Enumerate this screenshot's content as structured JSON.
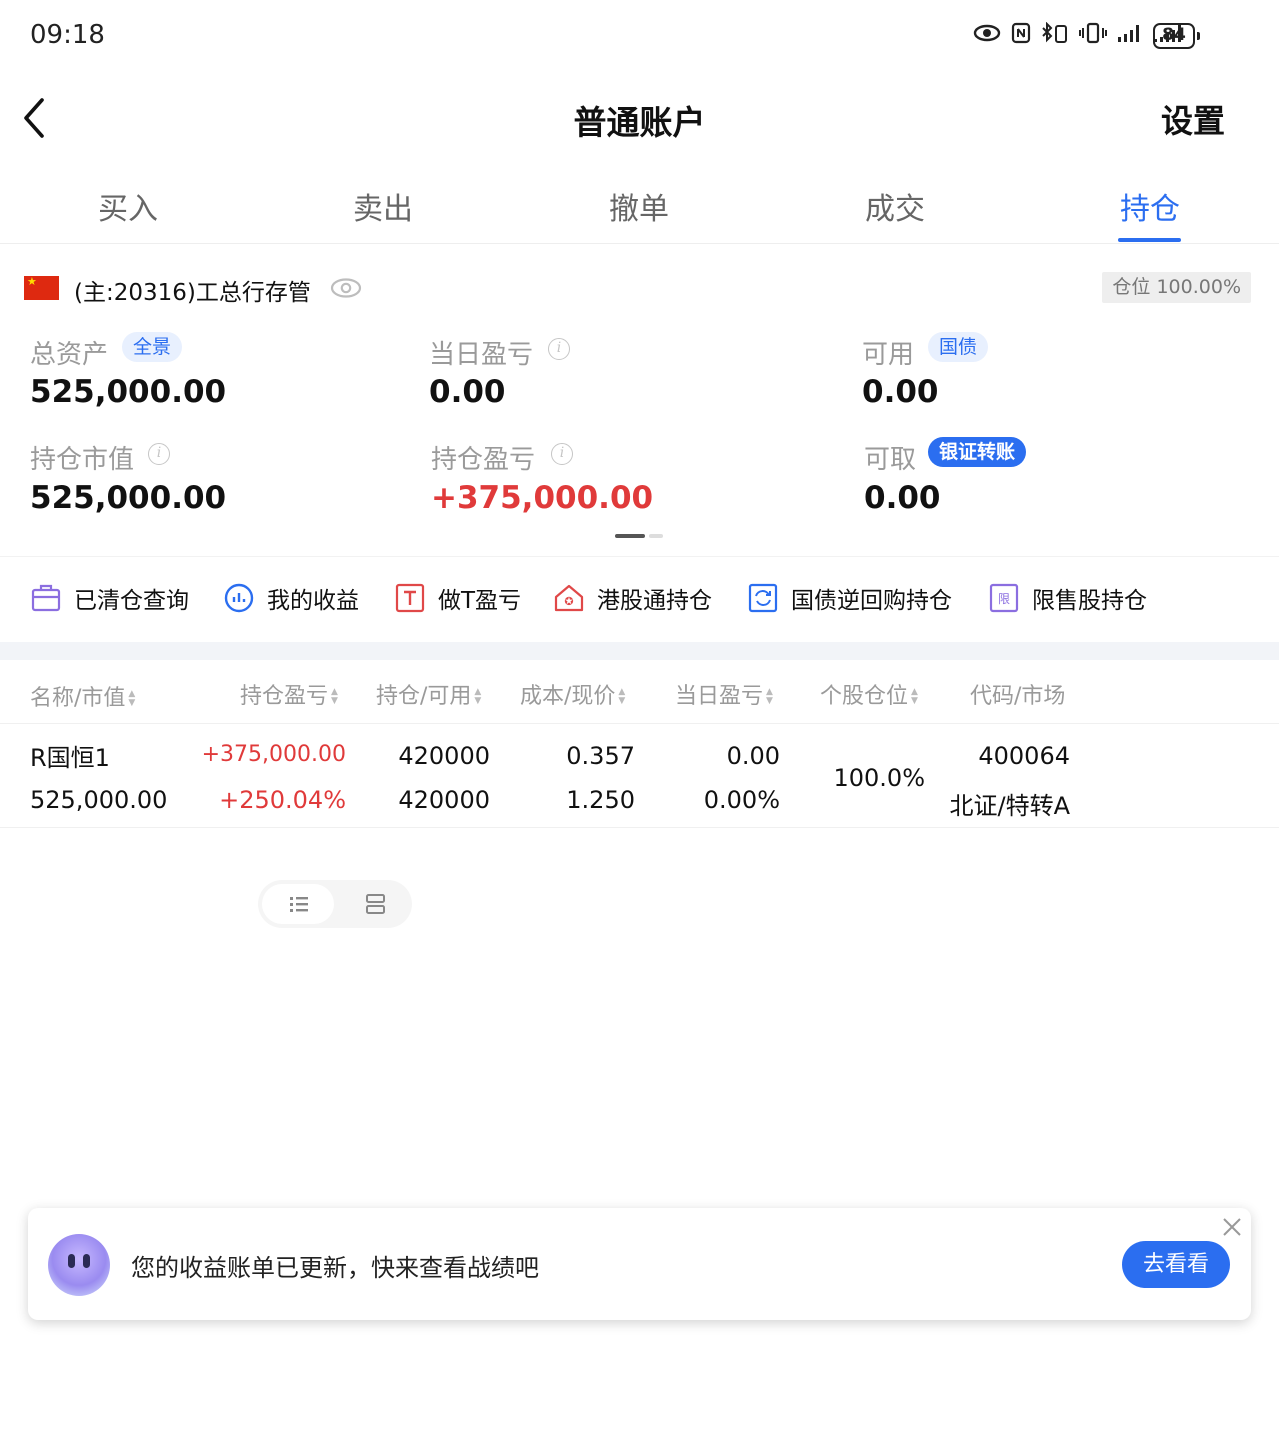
{
  "status_bar": {
    "time": "09:18",
    "battery": "84"
  },
  "header": {
    "title": "普通账户",
    "settings_label": "设置"
  },
  "tabs": [
    {
      "label": "买入"
    },
    {
      "label": "卖出"
    },
    {
      "label": "撤单"
    },
    {
      "label": "成交"
    },
    {
      "label": "持仓",
      "active": true
    }
  ],
  "account": {
    "name": "(主:20316)工总行存管",
    "position_tag": "仓位 100.00%"
  },
  "summary": {
    "total_assets": {
      "label": "总资产",
      "pill": "全景",
      "value": "525,000.00"
    },
    "daily_pnl": {
      "label": "当日盈亏",
      "value": "0.00"
    },
    "available": {
      "label": "可用",
      "pill": "国债",
      "value": "0.00"
    },
    "market_value": {
      "label": "持仓市值",
      "value": "525,000.00"
    },
    "position_pnl": {
      "label": "持仓盈亏",
      "value": "+375,000.00"
    },
    "withdrawable": {
      "label": "可取",
      "pill": "银证转账",
      "value": "0.00"
    }
  },
  "quick_links": [
    {
      "label": "已清仓查询",
      "icon": "briefcase-icon"
    },
    {
      "label": "我的收益",
      "icon": "chart-circle-icon"
    },
    {
      "label": "做T盈亏",
      "icon": "t-box-icon"
    },
    {
      "label": "港股通持仓",
      "icon": "house-star-icon"
    },
    {
      "label": "国债逆回购持仓",
      "icon": "refresh-box-icon"
    },
    {
      "label": "限售股持仓",
      "icon": "limit-box-icon"
    }
  ],
  "table": {
    "headers": [
      "名称/市值",
      "持仓盈亏",
      "持仓/可用",
      "成本/现价",
      "当日盈亏",
      "个股仓位",
      "代码/市场"
    ],
    "rows": [
      {
        "name": "R国恒1",
        "market_value": "525,000.00",
        "pnl": "+375,000.00",
        "pnl_pct": "+250.04%",
        "holding": "420000",
        "available": "420000",
        "cost": "0.357",
        "price": "1.250",
        "daily_pnl": "0.00",
        "daily_pct": "0.00%",
        "position_pct": "100.0%",
        "code": "400064",
        "market": "北证/特转A"
      }
    ]
  },
  "banner": {
    "text": "您的收益账单已更新，快来查看战绩吧",
    "button": "去看看"
  },
  "colors": {
    "accent": "#2b6ef0",
    "gain": "#e03a3a",
    "muted": "#9a9a9a"
  }
}
